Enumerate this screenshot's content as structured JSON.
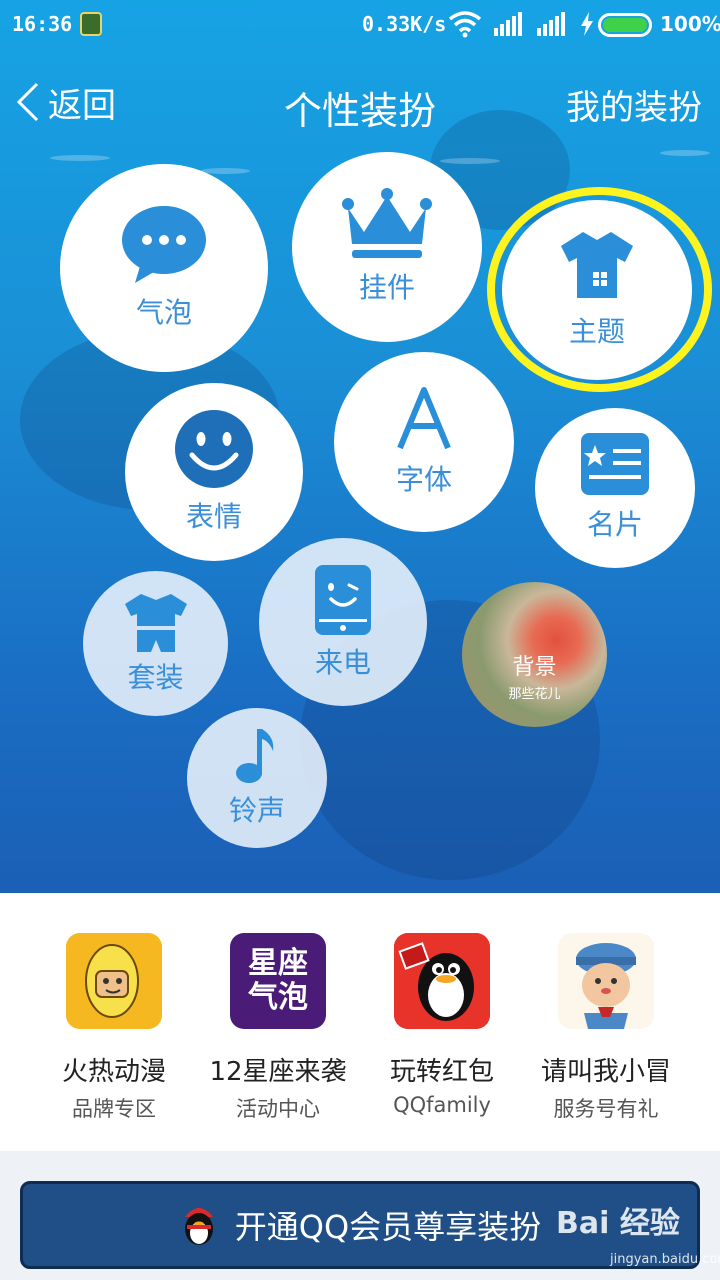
{
  "status_bar": {
    "time": "16:36",
    "speed": "0.33K/s",
    "battery_percent": "100%",
    "battery_level": 1.0
  },
  "nav": {
    "back_label": "返回",
    "title": "个性装扮",
    "my_label": "我的装扮"
  },
  "categories": {
    "bubble": "气泡",
    "pendant": "挂件",
    "theme": "主题",
    "emoticon": "表情",
    "font": "字体",
    "card": "名片",
    "suit": "套装",
    "call": "来电",
    "background": "背景",
    "background_sub": "那些花儿",
    "ringtone": "铃声"
  },
  "promos": [
    {
      "name": "火热动漫",
      "desc": "品牌专区"
    },
    {
      "name": "12星座来袭",
      "desc": "活动中心",
      "thumb_text_1": "星座",
      "thumb_text_2": "气泡"
    },
    {
      "name": "玩转红包",
      "desc": "QQfamily"
    },
    {
      "name": "请叫我小冒",
      "desc": "服务号有礼"
    }
  ],
  "cta": {
    "label": "开通QQ会员尊享装扮"
  },
  "watermark": {
    "brand": "Bai 经验",
    "url": "jingyan.baidu.com"
  },
  "colors": {
    "accent": "#2a8ed8",
    "highlight": "#fdf31f",
    "cta_bg": "#1f4f86"
  }
}
